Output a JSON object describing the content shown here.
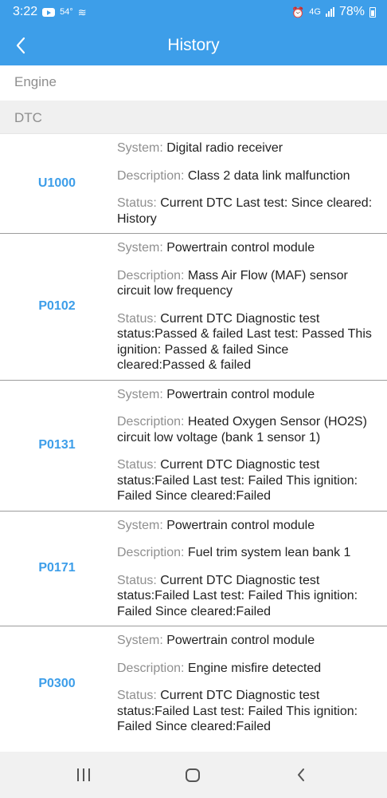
{
  "status_bar": {
    "time": "3:22",
    "temperature": "54°",
    "network": "4G",
    "battery": "78%"
  },
  "app_bar": {
    "title": "History"
  },
  "sections": {
    "engine": "Engine",
    "dtc": "DTC"
  },
  "labels": {
    "system": "System: ",
    "description": "Description: ",
    "status": "Status: "
  },
  "colors": {
    "accent": "#3d9ee9",
    "label_gray": "#8f8f8f",
    "divider": "#9c9c9c"
  },
  "dtcs": [
    {
      "code": "U1000",
      "system": "Digital radio receiver",
      "description": "Class 2 data link malfunction",
      "status": "Current DTC Last test: Since cleared: History"
    },
    {
      "code": "P0102",
      "system": "Powertrain control module",
      "description": "Mass Air Flow (MAF) sensor circuit low frequency",
      "status": "Current DTC Diagnostic test status:Passed & failed Last test: Passed This ignition: Passed & failed Since cleared:Passed & failed"
    },
    {
      "code": "P0131",
      "system": "Powertrain control module",
      "description": "Heated Oxygen Sensor (HO2S) circuit low voltage (bank 1 sensor 1)",
      "status": "Current DTC Diagnostic test status:Failed Last test: Failed This ignition: Failed Since cleared:Failed"
    },
    {
      "code": "P0171",
      "system": "Powertrain control module",
      "description": "Fuel trim system lean bank 1",
      "status": "Current DTC Diagnostic test status:Failed Last test: Failed This ignition: Failed Since cleared:Failed"
    },
    {
      "code": "P0300",
      "system": "Powertrain control module",
      "description": "Engine misfire detected",
      "status": "Current DTC Diagnostic test status:Failed Last test: Failed This ignition: Failed Since cleared:Failed"
    }
  ]
}
